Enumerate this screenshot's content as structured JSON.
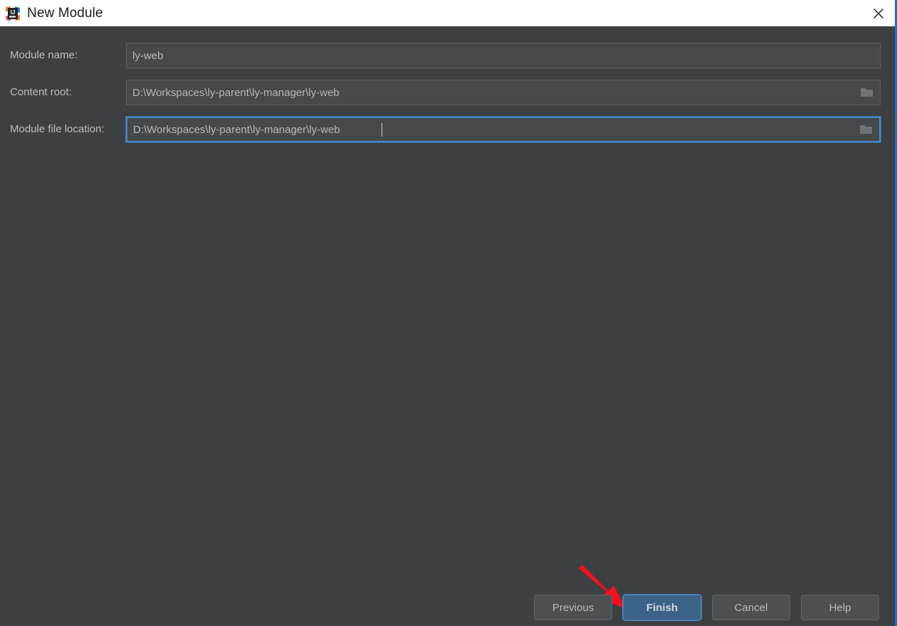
{
  "window": {
    "title": "New Module",
    "app_icon": "intellij-idea-icon",
    "close_icon": "close-icon",
    "accent_border_color": "#2d6ab4",
    "background_color": "#3c4043",
    "titlebar_background": "#ffffff"
  },
  "form": {
    "fields": [
      {
        "label": "Module name:",
        "value": "ly-web",
        "has_browse": false,
        "focused": false,
        "browse_icon": ""
      },
      {
        "label": "Content root:",
        "value": "D:\\Workspaces\\ly-parent\\ly-manager\\ly-web",
        "has_browse": true,
        "focused": false,
        "browse_icon": "folder-icon"
      },
      {
        "label": "Module file location:",
        "value": "D:\\Workspaces\\ly-parent\\ly-manager\\ly-web",
        "has_browse": true,
        "focused": true,
        "browse_icon": "folder-icon"
      }
    ]
  },
  "annotation": {
    "type": "red-arrow",
    "color": "#fc0d1b",
    "points_to": "finish-button"
  },
  "buttons": {
    "previous": "Previous",
    "finish": "Finish",
    "cancel": "Cancel",
    "help": "Help",
    "default_button": "Finish",
    "primary_color": "#3c6287"
  }
}
